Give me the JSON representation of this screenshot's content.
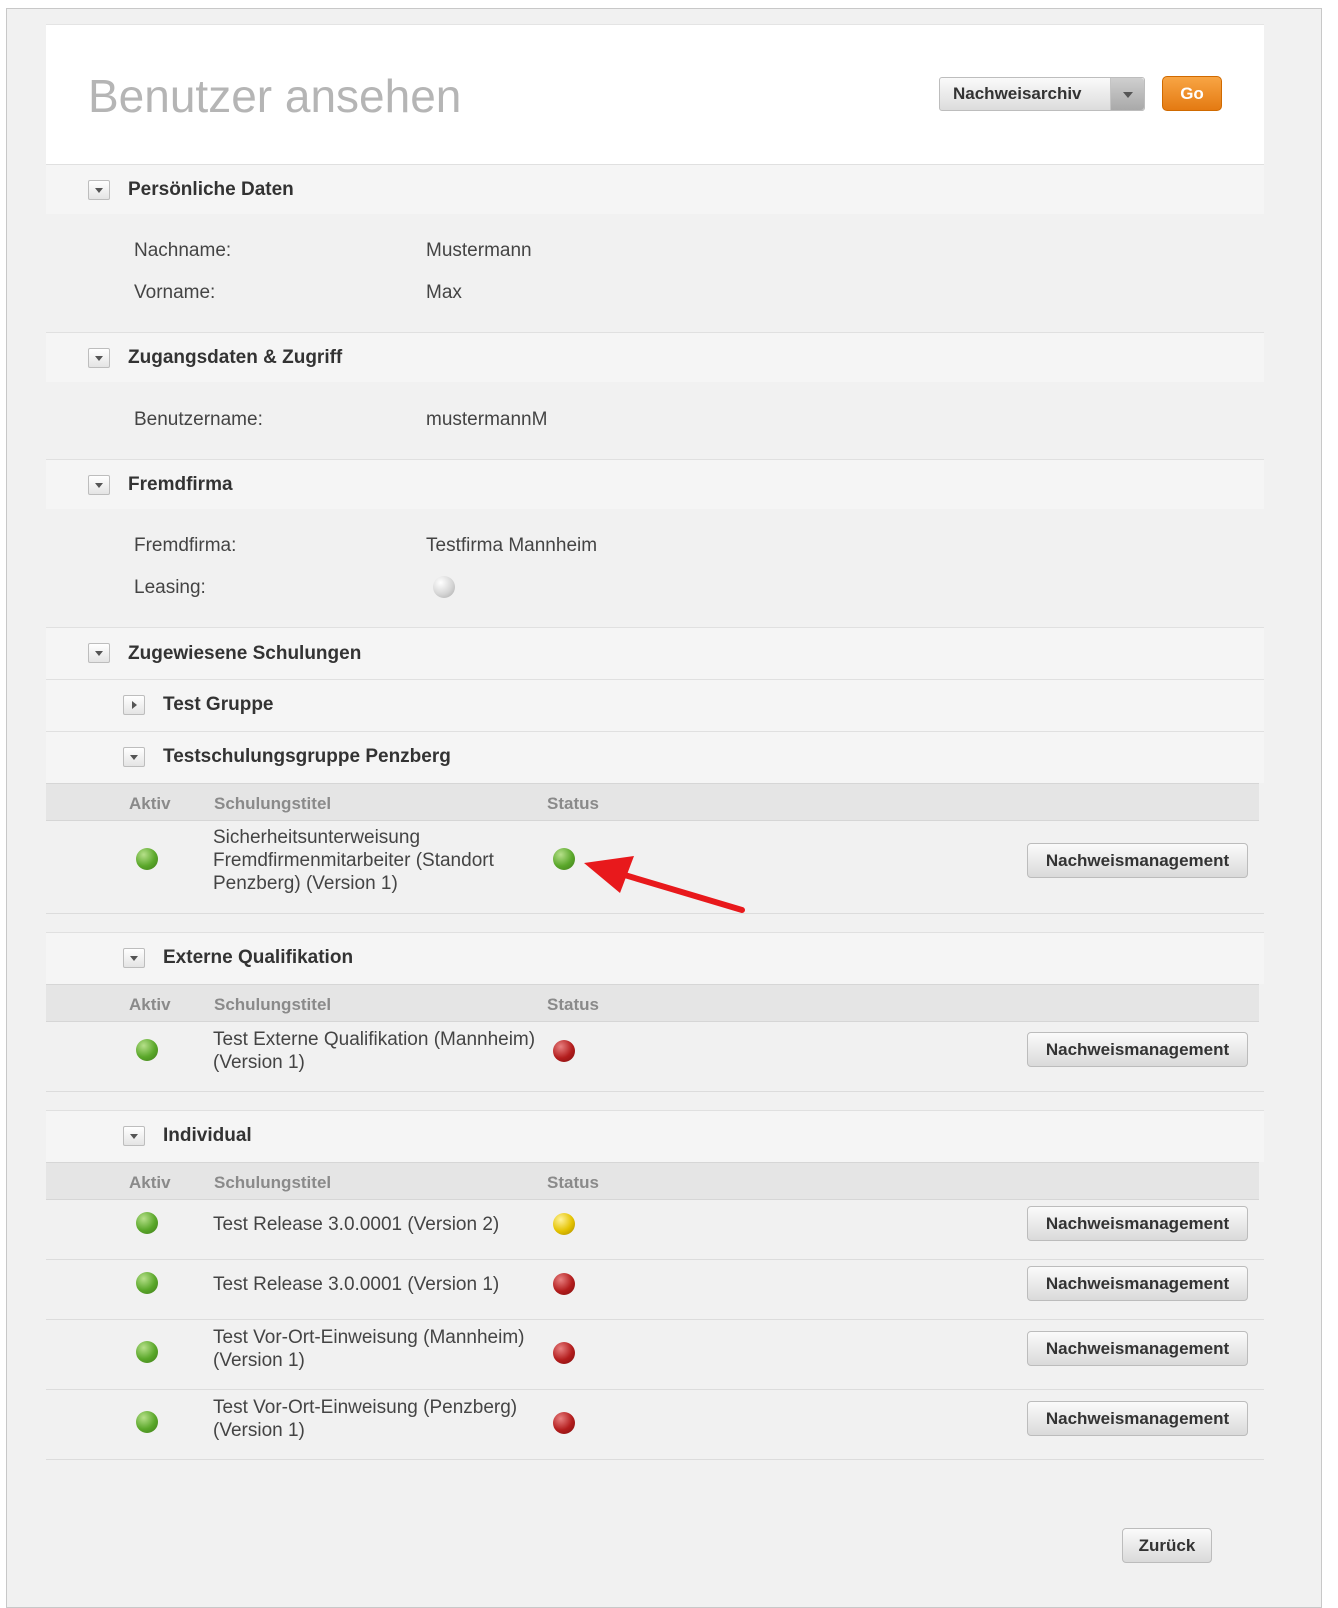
{
  "header": {
    "title": "Benutzer ansehen",
    "archive_select": "Nachweisarchiv",
    "go_label": "Go"
  },
  "personal": {
    "title": "Persönliche Daten",
    "lastname_label": "Nachname:",
    "lastname_value": "Mustermann",
    "firstname_label": "Vorname:",
    "firstname_value": "Max"
  },
  "access": {
    "title": "Zugangsdaten & Zugriff",
    "username_label": "Benutzername:",
    "username_value": "mustermannM"
  },
  "company": {
    "title": "Fremdfirma",
    "company_label": "Fremdfirma:",
    "company_value": "Testfirma Mannheim",
    "leasing_label": "Leasing:",
    "leasing_status": "grey"
  },
  "trainings": {
    "title": "Zugewiesene Schulungen",
    "columns": {
      "active": "Aktiv",
      "title": "Schulungstitel",
      "status": "Status"
    },
    "button_label": "Nachweismanagement",
    "groups": [
      {
        "title": "Test Gruppe",
        "expanded": false,
        "rows": []
      },
      {
        "title": "Testschulungsgruppe Penzberg",
        "expanded": true,
        "rows": [
          {
            "title": "Sicherheitsunterweisung Fremdfirmenmitarbeiter (Standort Penzberg) (Version 1)",
            "active": "green",
            "status": "green"
          }
        ]
      },
      {
        "title": "Externe Qualifikation",
        "expanded": true,
        "rows": [
          {
            "title": "Test Externe Qualifikation (Mannheim) (Version 1)",
            "active": "green",
            "status": "red"
          }
        ]
      },
      {
        "title": "Individual",
        "expanded": true,
        "rows": [
          {
            "title": "Test Release 3.0.0001 (Version 2)",
            "active": "green",
            "status": "yellow"
          },
          {
            "title": "Test Release 3.0.0001 (Version 1)",
            "active": "green",
            "status": "red"
          },
          {
            "title": "Test Vor-Ort-Einweisung (Mannheim) (Version 1)",
            "active": "green",
            "status": "red"
          },
          {
            "title": "Test Vor-Ort-Einweisung (Penzberg) (Version 1)",
            "active": "green",
            "status": "red"
          }
        ]
      }
    ]
  },
  "footer": {
    "back_label": "Zurück"
  },
  "colors": {
    "accent": "#e88218",
    "annotation_arrow": "#e8191c"
  }
}
